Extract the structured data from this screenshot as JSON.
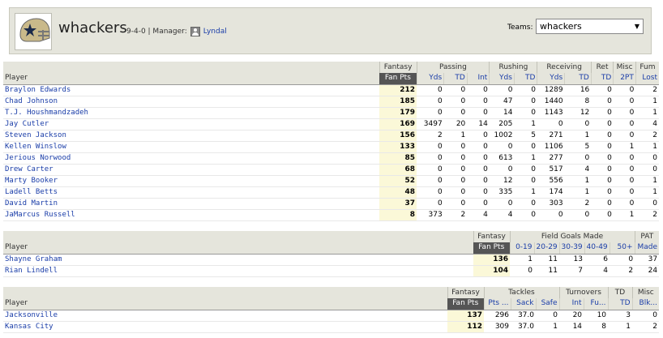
{
  "header": {
    "team_name": "whackers",
    "record": "9-4-0 | Manager:",
    "manager": "Lyndal",
    "teams_label": "Teams:",
    "teams_selected": "whackers"
  },
  "offense": {
    "groups": [
      "Fantasy",
      "Passing",
      "Rushing",
      "Receiving",
      "Ret",
      "Misc",
      "Fum"
    ],
    "player_label": "Player",
    "cols": [
      "Fan Pts",
      "Yds",
      "TD",
      "Int",
      "Yds",
      "TD",
      "Yds",
      "TD",
      "TD",
      "2PT",
      "Lost"
    ],
    "rows": [
      [
        "Braylon Edwards",
        "212",
        "0",
        "0",
        "0",
        "0",
        "0",
        "1289",
        "16",
        "0",
        "0",
        "2"
      ],
      [
        "Chad Johnson",
        "185",
        "0",
        "0",
        "0",
        "47",
        "0",
        "1440",
        "8",
        "0",
        "0",
        "1"
      ],
      [
        "T.J. Houshmandzadeh",
        "179",
        "0",
        "0",
        "0",
        "14",
        "0",
        "1143",
        "12",
        "0",
        "0",
        "1"
      ],
      [
        "Jay Cutler",
        "169",
        "3497",
        "20",
        "14",
        "205",
        "1",
        "0",
        "0",
        "0",
        "0",
        "4"
      ],
      [
        "Steven Jackson",
        "156",
        "2",
        "1",
        "0",
        "1002",
        "5",
        "271",
        "1",
        "0",
        "0",
        "2"
      ],
      [
        "Kellen Winslow",
        "133",
        "0",
        "0",
        "0",
        "0",
        "0",
        "1106",
        "5",
        "0",
        "1",
        "1"
      ],
      [
        "Jerious Norwood",
        "85",
        "0",
        "0",
        "0",
        "613",
        "1",
        "277",
        "0",
        "0",
        "0",
        "0"
      ],
      [
        "Drew Carter",
        "68",
        "0",
        "0",
        "0",
        "0",
        "0",
        "517",
        "4",
        "0",
        "0",
        "0"
      ],
      [
        "Marty Booker",
        "52",
        "0",
        "0",
        "0",
        "12",
        "0",
        "556",
        "1",
        "0",
        "0",
        "1"
      ],
      [
        "Ladell Betts",
        "48",
        "0",
        "0",
        "0",
        "335",
        "1",
        "174",
        "1",
        "0",
        "0",
        "1"
      ],
      [
        "David Martin",
        "37",
        "0",
        "0",
        "0",
        "0",
        "0",
        "303",
        "2",
        "0",
        "0",
        "0"
      ],
      [
        "JaMarcus Russell",
        "8",
        "373",
        "2",
        "4",
        "4",
        "0",
        "0",
        "0",
        "0",
        "1",
        "2"
      ]
    ]
  },
  "kicker": {
    "groups": [
      "Fantasy",
      "Field Goals Made",
      "PAT"
    ],
    "player_label": "Player",
    "cols": [
      "Fan Pts",
      "0-19",
      "20-29",
      "30-39",
      "40-49",
      "50+",
      "Made"
    ],
    "rows": [
      [
        "Shayne Graham",
        "136",
        "1",
        "11",
        "13",
        "6",
        "0",
        "37"
      ],
      [
        "Rian Lindell",
        "104",
        "0",
        "11",
        "7",
        "4",
        "2",
        "24"
      ]
    ]
  },
  "defense": {
    "groups": [
      "Fantasy",
      "Tackles",
      "Turnovers",
      "TD",
      "Misc"
    ],
    "player_label": "Player",
    "cols": [
      "Fan Pts",
      "Pts ...",
      "Sack",
      "Safe",
      "Int",
      "Fu...",
      "TD",
      "Blk..."
    ],
    "rows": [
      [
        "Jacksonville",
        "137",
        "296",
        "37.0",
        "0",
        "20",
        "10",
        "3",
        "0"
      ],
      [
        "Kansas City",
        "112",
        "309",
        "37.0",
        "1",
        "14",
        "8",
        "1",
        "2"
      ]
    ]
  }
}
